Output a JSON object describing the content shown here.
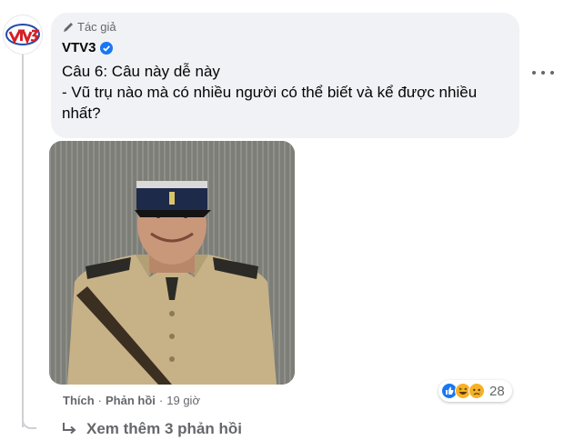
{
  "comment": {
    "avatar_icon": "vtv3-logo",
    "author_badge": "Tác giả",
    "author_name": "VTV3",
    "verified_icon": "verified-badge-icon",
    "text_line1": "Câu 6: Câu này dễ này",
    "text_line2": "- Vũ trụ nào mà có nhiều người có thể biết và kể được nhiều nhất?",
    "image_description_icon": "photo-man-in-police-uniform"
  },
  "actions": {
    "like": "Thích",
    "reply": "Phản hồi",
    "time": "19 giờ",
    "separator": "·"
  },
  "reactions": {
    "icons": [
      "like-reaction-icon",
      "haha-reaction-icon",
      "sad-reaction-icon"
    ],
    "count": "28"
  },
  "see_more": {
    "label": "Xem thêm 3 phản hồi"
  },
  "colors": {
    "bubble": "#f0f2f5",
    "secondary_text": "#65676b",
    "link_blue": "#1877f2"
  }
}
